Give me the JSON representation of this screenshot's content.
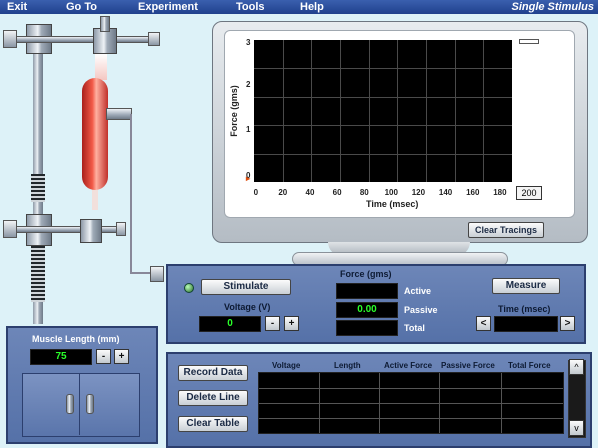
{
  "menu": {
    "items": [
      "Exit",
      "Go To",
      "Experiment",
      "Tools",
      "Help"
    ],
    "title": "Single Stimulus"
  },
  "graph": {
    "y_title": "Force (gms)",
    "x_title": "Time (msec)",
    "y_ticks": [
      "0",
      "1",
      "2",
      "3"
    ],
    "x_ticks": [
      "0",
      "20",
      "40",
      "60",
      "80",
      "100",
      "120",
      "140",
      "160",
      "180"
    ],
    "x_max_value": "200",
    "clear_button": "Clear Tracings"
  },
  "stimulator": {
    "stimulate_button": "Stimulate",
    "voltage_label": "Voltage (V)",
    "voltage_value": "0",
    "minus": "-",
    "plus": "+",
    "force_header": "Force (gms)",
    "active_label": "Active",
    "passive_label": "Passive",
    "total_label": "Total",
    "active_value": "",
    "passive_value": "0.00",
    "total_value": "",
    "measure_button": "Measure",
    "time_label": "Time (msec)",
    "time_value": "",
    "time_left": "<",
    "time_right": ">"
  },
  "muscle_length": {
    "label": "Muscle Length (mm)",
    "value": "75",
    "minus": "-",
    "plus": "+"
  },
  "data_table": {
    "record_button": "Record Data",
    "delete_button": "Delete Line",
    "clear_button": "Clear Table",
    "columns": [
      "Voltage",
      "Length",
      "Active Force",
      "Passive Force",
      "Total Force"
    ],
    "scroll_up": "^",
    "scroll_down": "v"
  },
  "colors": {
    "panel": "#5f7ab0",
    "readout_text": "#2aff2a",
    "menubar": "#2a4d9c",
    "background": "#ddf2f8"
  }
}
